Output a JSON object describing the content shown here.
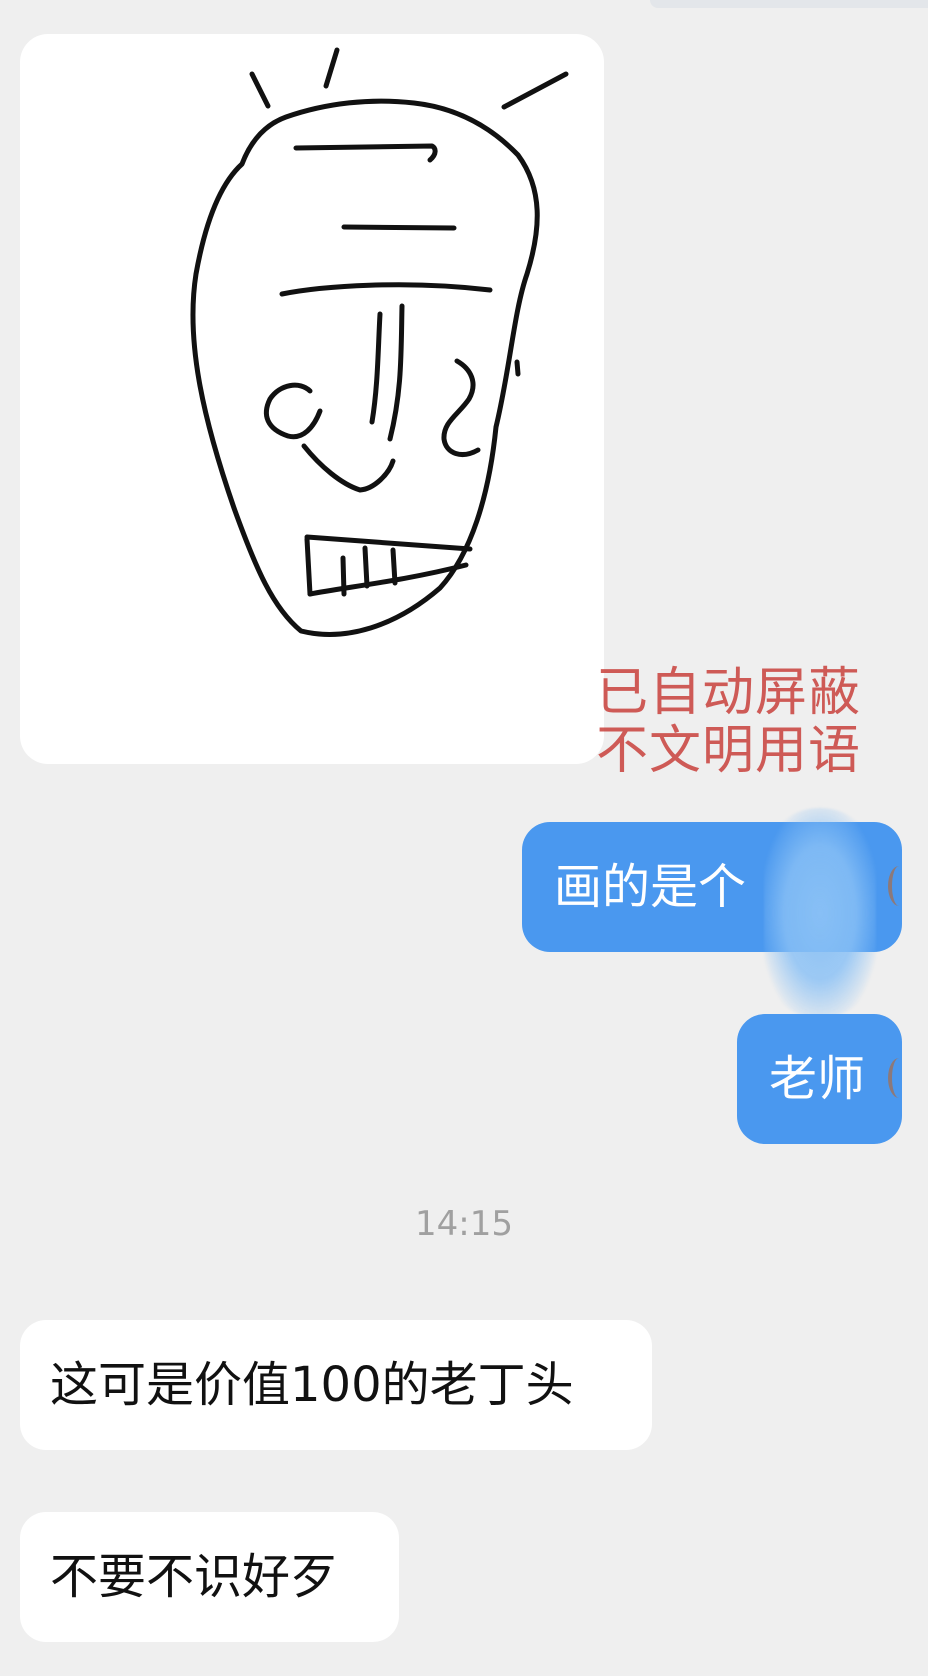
{
  "conversation": {
    "image_message": {
      "image_label": "drawing-image"
    },
    "annotation": {
      "line1": "已自动屏蔽",
      "line2": "不文明用语"
    },
    "messages": [
      {
        "text": "画的是个",
        "sender": "self"
      },
      {
        "text": "老师",
        "sender": "self"
      },
      {
        "text": "这可是价值100的老丁头",
        "sender": "other"
      },
      {
        "text": "不要不识好歹",
        "sender": "other"
      }
    ],
    "timestamp": "14:15"
  },
  "colors": {
    "background": "#efefef",
    "self_bubble": "#4a98ef",
    "other_bubble": "#ffffff",
    "annotation_text": "#c9413c",
    "timestamp_text": "#a0a0a0"
  }
}
